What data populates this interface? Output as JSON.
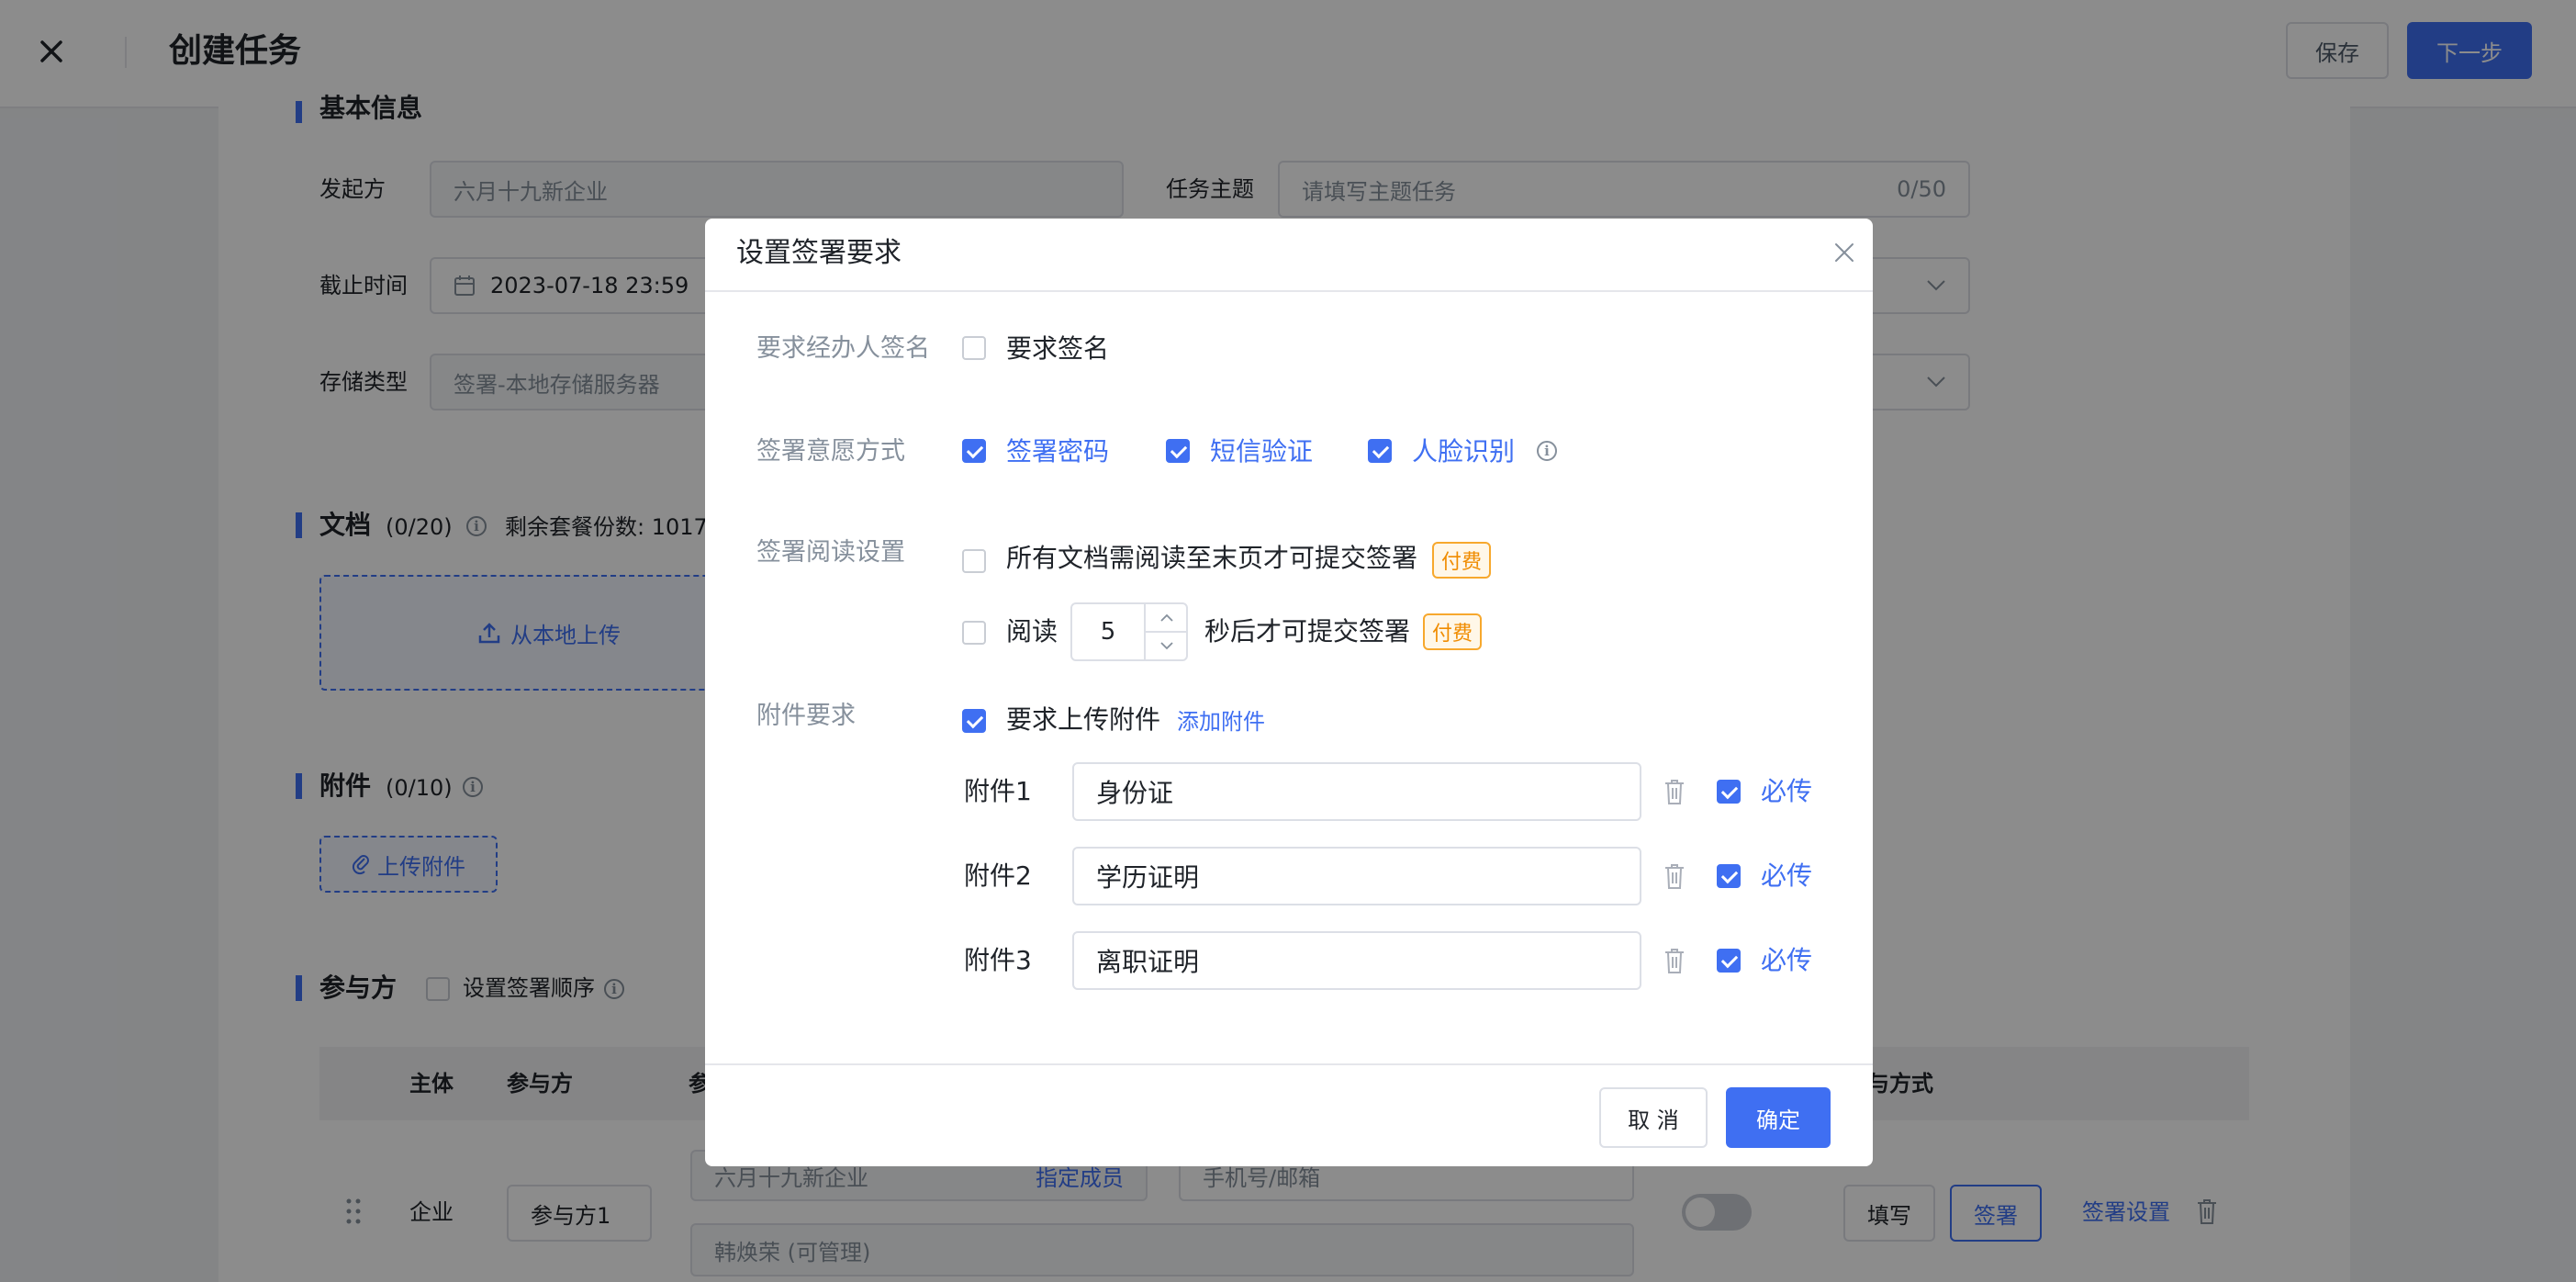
{
  "header": {
    "title": "创建任务",
    "save_label": "保存",
    "next_label": "下一步"
  },
  "basic": {
    "section_title": "基本信息",
    "initiator_label": "发起方",
    "initiator_value": "六月十九新企业",
    "subject_label": "任务主题",
    "subject_placeholder": "请填写主题任务",
    "subject_count": "0/50",
    "deadline_label": "截止时间",
    "deadline_value": "2023-07-18 23:59",
    "storage_label": "存储类型",
    "storage_value": "签署-本地存储服务器"
  },
  "documents": {
    "title": "文档",
    "count": "(0/20)",
    "remaining": "剩余套餐份数: 1017",
    "upload_label": "从本地上传"
  },
  "attachments": {
    "title": "附件",
    "count": "(0/10)",
    "upload_label": "上传附件"
  },
  "participants": {
    "title": "参与方",
    "order_label": "设置签署顺序",
    "columns": [
      "主体",
      "参与方",
      "参",
      "与方式"
    ],
    "row": {
      "type": "企业",
      "name": "参与方1",
      "company": "六月十九新企业",
      "assign_member": "指定成员",
      "phone_placeholder": "手机号/邮箱",
      "person": "韩焕荣 (可管理)",
      "fill_label": "填写",
      "sign_label": "签署",
      "sign_settings_label": "签署设置"
    }
  },
  "modal": {
    "title": "设置签署要求",
    "operator_sign": {
      "label": "要求经办人签名",
      "option": "要求签名",
      "checked": false
    },
    "intent": {
      "label": "签署意愿方式",
      "options": [
        {
          "label": "签署密码",
          "checked": true
        },
        {
          "label": "短信验证",
          "checked": true
        },
        {
          "label": "人脸识别",
          "checked": true
        }
      ]
    },
    "reading": {
      "label": "签署阅读设置",
      "opt1": "所有文档需阅读至末页才可提交签署",
      "opt1_tag": "付费",
      "opt2_prefix": "阅读",
      "opt2_value": "5",
      "opt2_suffix": "秒后才可提交签署",
      "opt2_tag": "付费"
    },
    "attachment_req": {
      "label": "附件要求",
      "option": "要求上传附件",
      "checked": true,
      "add_link": "添加附件",
      "required_label": "必传",
      "items": [
        {
          "label": "附件1",
          "value": "身份证",
          "required": true
        },
        {
          "label": "附件2",
          "value": "学历证明",
          "required": true
        },
        {
          "label": "附件3",
          "value": "离职证明",
          "required": true
        }
      ]
    },
    "cancel_label": "取 消",
    "ok_label": "确定"
  },
  "colors": {
    "accent": "#3f6ff2",
    "paid_tag": "#f08c00",
    "overlay": "rgba(0,0,0,0.45)"
  }
}
